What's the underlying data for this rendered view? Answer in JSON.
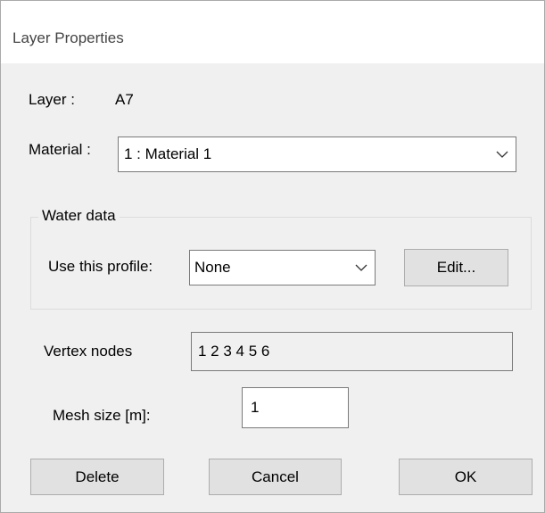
{
  "window": {
    "title": "Layer Properties"
  },
  "layer": {
    "label": "Layer :",
    "value": "A7"
  },
  "material": {
    "label": "Material :",
    "selected": "1 : Material 1",
    "arrow_icon": "chevron-down-icon"
  },
  "water_data": {
    "group_label": "Water data",
    "profile_label": "Use this profile:",
    "profile_selected": "None",
    "arrow_icon": "chevron-down-icon",
    "edit_button": "Edit..."
  },
  "vertex_nodes": {
    "label": "Vertex nodes",
    "value": "1 2 3 4 5 6"
  },
  "mesh_size": {
    "label": "Mesh size [m]:",
    "value": "1"
  },
  "buttons": {
    "delete": "Delete",
    "cancel": "Cancel",
    "ok": "OK"
  },
  "colors": {
    "dialog_background": "#f0f0f0",
    "titlebar_background": "#ffffff",
    "button_face": "#e1e1e1",
    "border": "#7a7a7a"
  }
}
